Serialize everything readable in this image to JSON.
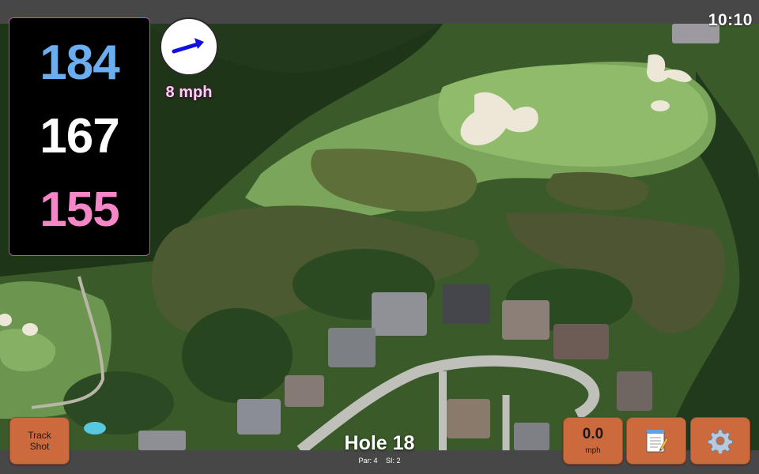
{
  "status": {
    "time": "10:10"
  },
  "distances": {
    "back": "184",
    "center": "167",
    "front": "155",
    "back_color": "#6aaef0",
    "center_color": "#ffffff",
    "front_color": "#f586c8"
  },
  "wind": {
    "speed_label": "8 mph",
    "direction_icon": "wind-arrow-icon",
    "arrow_color": "#1010e0"
  },
  "hole": {
    "title": "Hole 18",
    "par": "Par: 4",
    "si": "SI: 2"
  },
  "buttons": {
    "track_line1": "Track",
    "track_line2": "Shot",
    "speed_value": "0.0",
    "speed_unit": "mph",
    "notes_icon": "notepad-icon",
    "settings_icon": "gear-icon"
  },
  "colors": {
    "button": "#cc6a3d",
    "bar": "#474747",
    "panel_border": "#c04fa8"
  }
}
